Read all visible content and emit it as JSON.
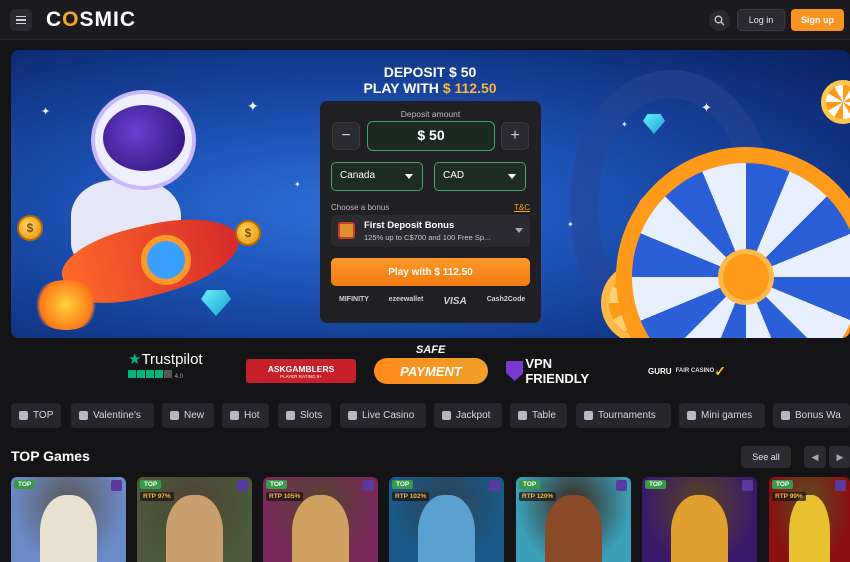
{
  "header": {
    "logo_text_pre": "C",
    "logo_text_o": "O",
    "logo_text_post": "SMIC",
    "login_label": "Log in",
    "signup_label": "Sign up"
  },
  "hero": {
    "title_line1": "DEPOSIT $ 50",
    "title_line2_prefix": "PLAY WITH ",
    "title_line2_amount": "$ 112.50",
    "coin_symbol": "$",
    "deposit": {
      "amount_label": "Deposit amount",
      "minus": "−",
      "plus": "+",
      "amount_value": "$ 50",
      "country": "Canada",
      "currency": "CAD",
      "bonus_label": "Choose a bonus",
      "tc_label": "T&C",
      "bonus_title": "First Deposit Bonus",
      "bonus_sub": "125% up to C$700 and 100 Free Sp...",
      "play_label": "Play with $ 112.50",
      "payments": [
        "MIFINITY",
        "ezeewallet",
        "VISA",
        "Cash2Code"
      ]
    }
  },
  "trust": {
    "trustpilot": "Trustpilot",
    "trustpilot_rating": "4.0",
    "askgamblers": "ASKGAMBLERS",
    "askgamblers_sub": "PLAYER RATING 9+",
    "safe_top": "SAFE",
    "safe_bottom": "PAYMENT",
    "vpn": "VPN FRIENDLY",
    "guru": "GURU",
    "guru_fair": "FAIR CASINO"
  },
  "categories": [
    "TOP",
    "Valentine's",
    "New",
    "Hot",
    "Slots",
    "Live Casino",
    "Jackpot",
    "Table",
    "Tournaments",
    "Mini games",
    "Bonus Wa"
  ],
  "top_games": {
    "title": "TOP Games",
    "see_all": "See all",
    "prev": "◀",
    "next": "▶",
    "cards": [
      {
        "badge": "TOP",
        "rtp": "",
        "bg": "#6a8ac8",
        "fig": "#e8e0d0"
      },
      {
        "badge": "TOP",
        "rtp": "RTP 97%",
        "bg": "#4a5a3a",
        "fig": "#c8a070"
      },
      {
        "badge": "TOP",
        "rtp": "RTP 105%",
        "bg": "#7a2a5a",
        "fig": "#d0a060"
      },
      {
        "badge": "TOP",
        "rtp": "RTP 102%",
        "bg": "#1a5a8a",
        "fig": "#5aa0d0"
      },
      {
        "badge": "TOP",
        "rtp": "RTP 120%",
        "bg": "#3aa0b8",
        "fig": "#8a4a2a"
      },
      {
        "badge": "TOP",
        "rtp": "",
        "bg": "#3a1a6a",
        "fig": "#e0a030"
      },
      {
        "badge": "TOP",
        "rtp": "RTP 99%",
        "bg": "#8a1010",
        "fig": "#e8c030"
      }
    ]
  }
}
